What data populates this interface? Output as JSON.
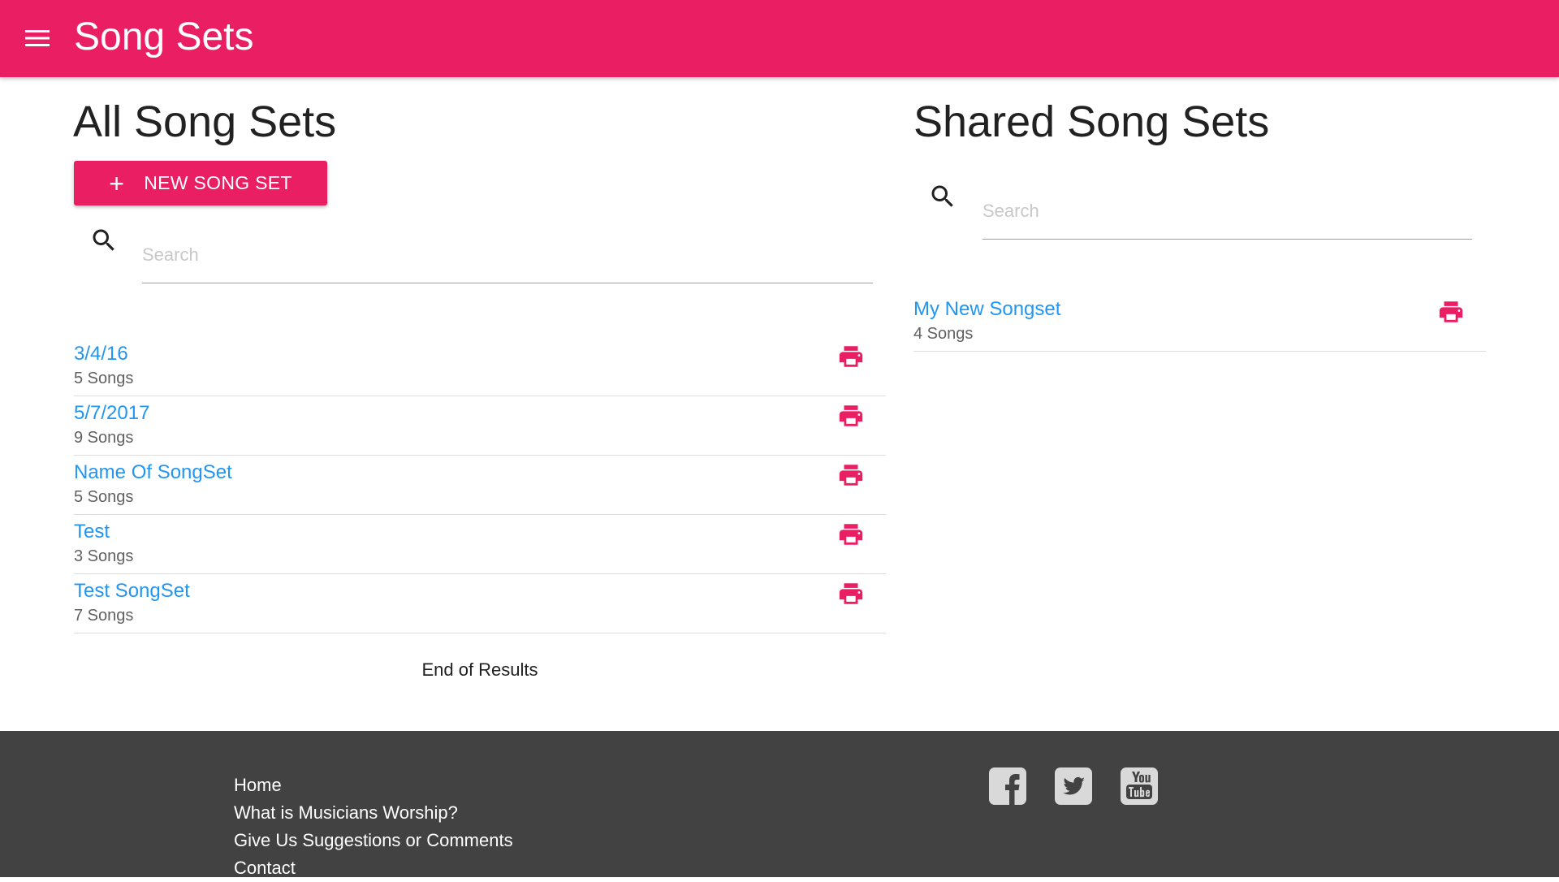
{
  "app_bar": {
    "title": "Song Sets",
    "menu_icon": "hamburger-menu-icon",
    "color": "#e91e63"
  },
  "all_song_sets": {
    "title": "All Song Sets",
    "new_button": {
      "icon": "plus-icon",
      "label": "NEW SONG SET"
    },
    "search": {
      "icon": "search-icon",
      "placeholder": "Search",
      "value": ""
    },
    "items": [
      {
        "name": "3/4/16",
        "count": "5 Songs",
        "action_icon": "print-icon"
      },
      {
        "name": "5/7/2017",
        "count": "9 Songs",
        "action_icon": "print-icon"
      },
      {
        "name": "Name Of SongSet",
        "count": "5 Songs",
        "action_icon": "print-icon"
      },
      {
        "name": "Test",
        "count": "3 Songs",
        "action_icon": "print-icon"
      },
      {
        "name": "Test SongSet",
        "count": "7 Songs",
        "action_icon": "print-icon"
      }
    ],
    "end_text": "End of Results"
  },
  "shared_song_sets": {
    "title": "Shared Song Sets",
    "search": {
      "icon": "search-icon",
      "placeholder": "Search",
      "value": ""
    },
    "items": [
      {
        "name": "My New Songset",
        "count": "4 Songs",
        "action_icon": "print-icon"
      }
    ]
  },
  "footer": {
    "links": [
      "Home",
      "What is Musicians Worship?",
      "Give Us Suggestions or Comments",
      "Contact"
    ],
    "social": [
      {
        "name": "facebook",
        "icon": "facebook-icon"
      },
      {
        "name": "twitter",
        "icon": "twitter-icon"
      },
      {
        "name": "youtube",
        "icon": "youtube-icon"
      }
    ],
    "background": "#424242"
  },
  "colors": {
    "accent": "#e91e63",
    "link": "#2196f3",
    "secondary_text": "#616161"
  }
}
